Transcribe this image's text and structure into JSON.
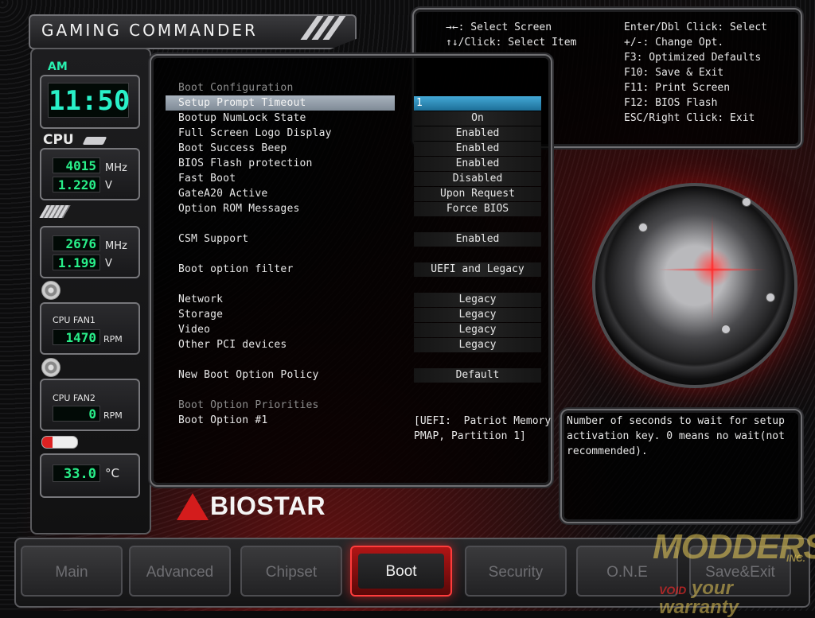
{
  "header": {
    "title": "GAMING COMMANDER"
  },
  "help": {
    "left": [
      {
        "key": "→←",
        "text": ": Select Screen"
      },
      {
        "key": "↑↓",
        "text": "/Click: Select Item"
      }
    ],
    "right": [
      "Enter/Dbl Click: Select",
      "+/-: Change Opt.",
      "F3: Optimized Defaults",
      "F10: Save & Exit",
      "F11: Print Screen",
      "F12: BIOS Flash",
      "ESC/Right Click: Exit"
    ]
  },
  "sidebar": {
    "clock": {
      "ampm": "AM",
      "time": "11:50"
    },
    "cpu_label": "CPU",
    "cpu": {
      "freq": "4015",
      "freq_unit": "MHz",
      "volt": "1.220",
      "volt_unit": "V"
    },
    "memory": {
      "freq": "2676",
      "freq_unit": "MHz",
      "volt": "1.199",
      "volt_unit": "V"
    },
    "fan1": {
      "label": "CPU FAN1",
      "rpm": "1470",
      "unit": "RPM"
    },
    "fan2": {
      "label": "CPU FAN2",
      "rpm": "0",
      "unit": "RPM"
    },
    "temp": {
      "value": "33.0",
      "unit": "°C"
    }
  },
  "menu": {
    "boot_config_heading": "Boot Configuration",
    "setup_prompt": {
      "label": "Setup Prompt Timeout",
      "value": "1"
    },
    "numlock": {
      "label": "Bootup NumLock State",
      "value": "On"
    },
    "logo": {
      "label": "Full Screen Logo Display",
      "value": "Enabled"
    },
    "beep": {
      "label": "Boot Success Beep",
      "value": "Enabled"
    },
    "flash_protect": {
      "label": "BIOS Flash protection",
      "value": "Enabled"
    },
    "fast_boot": {
      "label": "Fast Boot",
      "value": "Disabled"
    },
    "gatea20": {
      "label": "GateA20 Active",
      "value": "Upon Request"
    },
    "option_rom": {
      "label": "Option ROM Messages",
      "value": "Force BIOS"
    },
    "csm": {
      "label": "CSM Support",
      "value": "Enabled"
    },
    "boot_filter": {
      "label": "Boot option filter",
      "value": "UEFI and Legacy"
    },
    "network": {
      "label": "Network",
      "value": "Legacy"
    },
    "storage": {
      "label": "Storage",
      "value": "Legacy"
    },
    "video": {
      "label": "Video",
      "value": "Legacy"
    },
    "other_pci": {
      "label": "Other PCI devices",
      "value": "Legacy"
    },
    "new_boot_policy": {
      "label": "New Boot Option Policy",
      "value": "Default"
    },
    "priorities_heading": "Boot Option Priorities",
    "boot_option_1": {
      "label": "Boot Option #1",
      "value_line1": "[UEFI:  Patriot Memory",
      "value_line2": "PMAP, Partition 1]"
    }
  },
  "description": "Number of seconds to wait for setup activation key. 0 means no wait(not recommended).",
  "logo": {
    "text": "BIOSTAR"
  },
  "tabs": [
    "Main",
    "Advanced",
    "Chipset",
    "Boot",
    "Security",
    "O.N.E",
    "Save&Exit"
  ],
  "active_tab": "Boot",
  "watermark": {
    "top": "MODDERS",
    "inc": "INC.",
    "bottom_void": "VOID",
    "bottom": "your warranty"
  }
}
